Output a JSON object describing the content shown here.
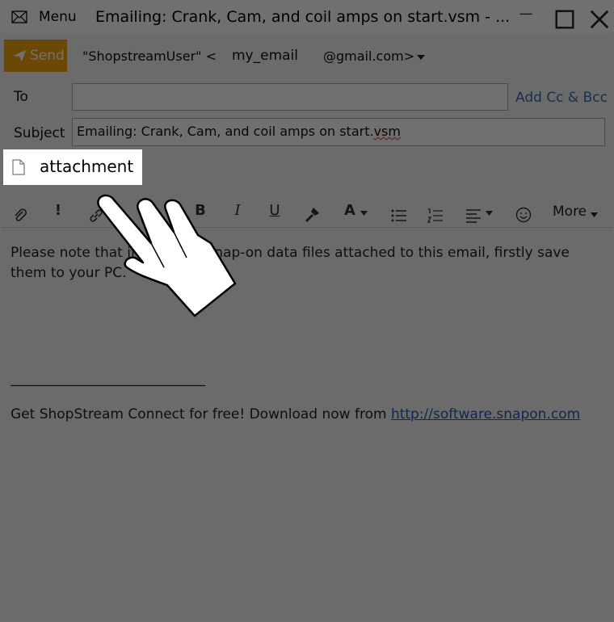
{
  "titlebar": {
    "menu_label": "Menu",
    "title": "Emailing: Crank, Cam, and coil amps on start.vsm - ...",
    "icons": {
      "mail": "mail-icon",
      "minimize": "minimize-icon",
      "maximize": "maximize-icon",
      "close": "close-icon"
    }
  },
  "compose": {
    "send_label": "Send",
    "from_name": "\"ShopstreamUser\" <",
    "from_user": "my_email",
    "from_domain": "@gmail.com>",
    "to_label": "To",
    "to_value": "",
    "add_cc_bcc": "Add Cc & Bcc",
    "subject_label": "Subject",
    "subject_value_pre": "Emailing: Crank, Cam, and coil amps on start.",
    "subject_value_ext": "vsm"
  },
  "attachment": {
    "label": "attachment"
  },
  "toolbar": {
    "bold": "B",
    "italic": "I",
    "underline": "U",
    "font_color": "A",
    "importance": "!",
    "more_label": "More"
  },
  "body": {
    "line1": "Please note that if you view Snap-on data files attached to this email, firstly save",
    "line2": "them to your PC.",
    "separator": "________________________________",
    "footer_pre": "Get ShopStream Connect for free! Download now from ",
    "footer_link": "http://software.snapon.com"
  },
  "colors": {
    "send_button": "#f3a50c",
    "link": "#2a55c8",
    "accent": "#3a6fb0"
  }
}
